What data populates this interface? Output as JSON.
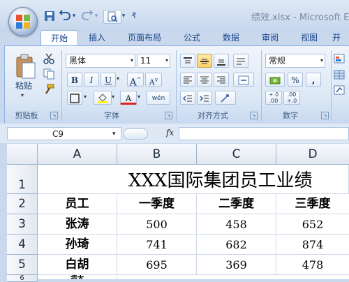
{
  "window": {
    "title": "绩效.xlsx - Microsoft Ex"
  },
  "qat": {
    "dropdown_glyph": "▾",
    "customize_glyph": "₹"
  },
  "tabs": [
    {
      "label": "开始",
      "active": true
    },
    {
      "label": "插入"
    },
    {
      "label": "页面布局"
    },
    {
      "label": "公式"
    },
    {
      "label": "数据"
    },
    {
      "label": "审阅"
    },
    {
      "label": "视图"
    },
    {
      "label": "开"
    }
  ],
  "ribbon": {
    "clipboard": {
      "paste_label": "粘贴",
      "group_label": "剪贴板"
    },
    "font": {
      "font_name": "黑体",
      "font_size": "11",
      "bold": "B",
      "italic": "I",
      "underline": "U",
      "grow": "A",
      "shrink": "A",
      "font_color_letter": "A",
      "phonetic": "wén",
      "group_label": "字体"
    },
    "alignment": {
      "group_label": "对齐方式"
    },
    "number": {
      "format": "常规",
      "percent": "%",
      "comma": ",",
      "inc_decimal": "+.0 .00",
      "dec_decimal": ".00 +.0",
      "group_label": "数字"
    }
  },
  "formula_bar": {
    "name_box": "C9",
    "fx_label": "fx",
    "formula": ""
  },
  "grid": {
    "columns": [
      "A",
      "B",
      "C",
      "D"
    ],
    "rows": [
      "1",
      "2",
      "3",
      "4",
      "5"
    ],
    "title": "XXX国际集团员工业绩",
    "header": [
      "员工",
      "一季度",
      "二季度",
      "三季度"
    ],
    "data": [
      [
        "张涛",
        "500",
        "458",
        "652"
      ],
      [
        "孙琦",
        "741",
        "682",
        "874"
      ],
      [
        "白胡",
        "695",
        "369",
        "478"
      ]
    ],
    "partial_row_label": "6",
    "partial_name": "浩天"
  },
  "colors": {
    "accent": "#15428b",
    "ribbon_border": "#8db2e3",
    "grid_line": "#d0d7e5"
  }
}
